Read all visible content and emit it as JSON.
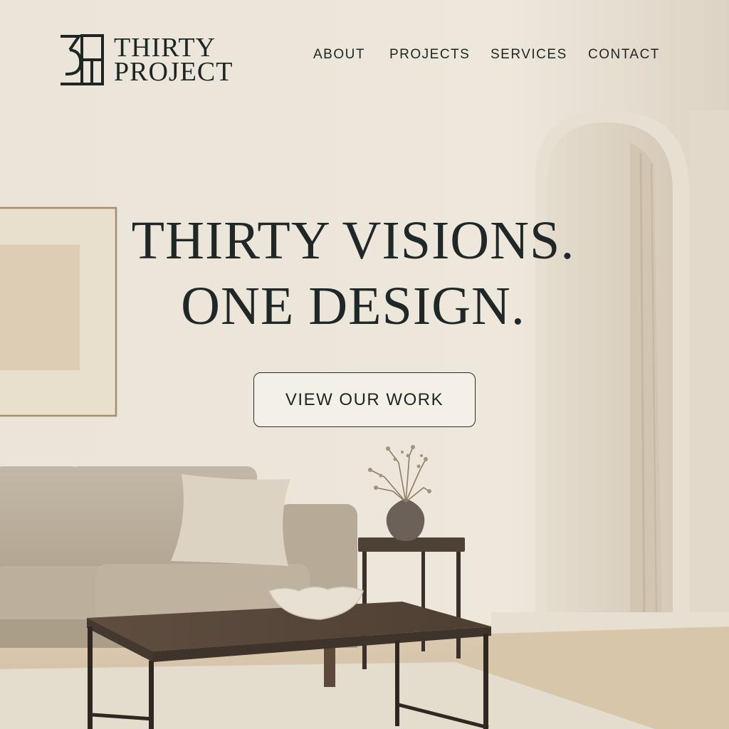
{
  "brand": {
    "line1": "THIRTY",
    "line2": "PROJECT",
    "logo_icon": "thirty-project-monogram-icon"
  },
  "nav": {
    "items": [
      {
        "label": "ABOUT"
      },
      {
        "label": "PROJECTS"
      },
      {
        "label": "SERVICES"
      },
      {
        "label": "CONTACT"
      }
    ]
  },
  "hero": {
    "title_line1": "THIRTY VISIONS.",
    "title_line2": "ONE DESIGN.",
    "cta_label": "VIEW OUR WORK"
  },
  "colors": {
    "ink": "#1e2624",
    "wall": "#ece5d9",
    "sofa": "#bfb3a1",
    "wood": "#5b4a3c",
    "floor": "#d9c8ae"
  }
}
